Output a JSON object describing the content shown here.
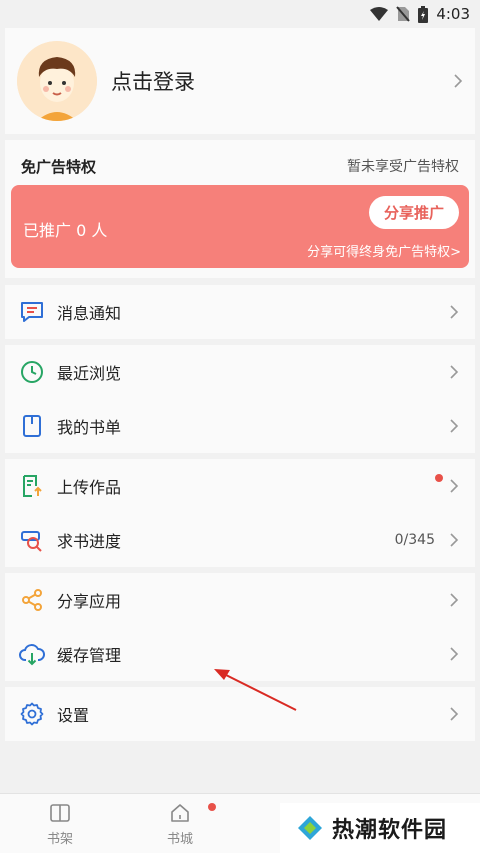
{
  "status_bar": {
    "time": "4:03"
  },
  "profile": {
    "login_label": "点击登录"
  },
  "adfree": {
    "title": "免广告特权",
    "status": "暂未享受广告特权",
    "promoted_count": "已推广 0 人",
    "share_button": "分享推广",
    "hint": "分享可得终身免广告特权>"
  },
  "menu": {
    "messages": "消息通知",
    "recent": "最近浏览",
    "booklist": "我的书单",
    "upload": "上传作品",
    "request_progress": "求书进度",
    "request_progress_value": "0/345",
    "share_app": "分享应用",
    "cache": "缓存管理",
    "settings": "设置"
  },
  "tabs": {
    "bookshelf": "书架",
    "bookstore": "书城"
  },
  "watermark": {
    "text": "热潮软件园"
  },
  "colors": {
    "accent": "#f6807a",
    "badge": "#e85149"
  }
}
